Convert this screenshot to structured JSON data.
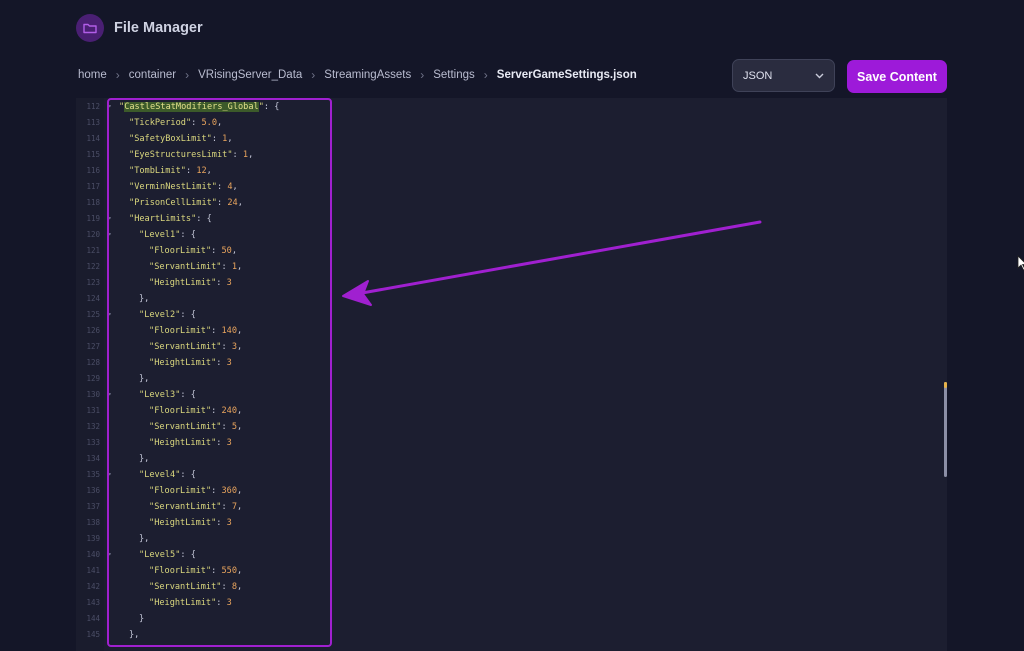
{
  "app": {
    "title": "File Manager",
    "icon": "folder-icon"
  },
  "breadcrumb": {
    "items": [
      "home",
      "container",
      "VRisingServer_Data",
      "StreamingAssets",
      "Settings"
    ],
    "current": "ServerGameSettings.json"
  },
  "toolbar": {
    "format_value": "JSON",
    "save_label": "Save Content"
  },
  "colors": {
    "accent": "#9d1ad9",
    "annotation": "#a020d0",
    "background": "#141628"
  },
  "editor": {
    "lines": [
      {
        "n": "112",
        "fold": true,
        "indent": 1,
        "key": "CastleStatModifiers_Global",
        "value": "",
        "suffix": ": {",
        "highlight": true
      },
      {
        "n": "113",
        "indent": 2,
        "key": "TickPeriod",
        "value": "5.0",
        "suffix": ","
      },
      {
        "n": "114",
        "indent": 2,
        "key": "SafetyBoxLimit",
        "value": "1",
        "suffix": ","
      },
      {
        "n": "115",
        "indent": 2,
        "key": "EyeStructuresLimit",
        "value": "1",
        "suffix": ","
      },
      {
        "n": "116",
        "indent": 2,
        "key": "TombLimit",
        "value": "12",
        "suffix": ","
      },
      {
        "n": "117",
        "indent": 2,
        "key": "VerminNestLimit",
        "value": "4",
        "suffix": ","
      },
      {
        "n": "118",
        "indent": 2,
        "key": "PrisonCellLimit",
        "value": "24",
        "suffix": ","
      },
      {
        "n": "119",
        "fold": true,
        "indent": 2,
        "key": "HeartLimits",
        "value": "",
        "suffix": ": {"
      },
      {
        "n": "120",
        "fold": true,
        "indent": 3,
        "key": "Level1",
        "value": "",
        "suffix": ": {"
      },
      {
        "n": "121",
        "indent": 4,
        "key": "FloorLimit",
        "value": "50",
        "suffix": ","
      },
      {
        "n": "122",
        "indent": 4,
        "key": "ServantLimit",
        "value": "1",
        "suffix": ","
      },
      {
        "n": "123",
        "indent": 4,
        "key": "HeightLimit",
        "value": "3",
        "suffix": ""
      },
      {
        "n": "124",
        "indent": 3,
        "key": "",
        "value": "",
        "suffix": "},"
      },
      {
        "n": "125",
        "fold": true,
        "indent": 3,
        "key": "Level2",
        "value": "",
        "suffix": ": {"
      },
      {
        "n": "126",
        "indent": 4,
        "key": "FloorLimit",
        "value": "140",
        "suffix": ","
      },
      {
        "n": "127",
        "indent": 4,
        "key": "ServantLimit",
        "value": "3",
        "suffix": ","
      },
      {
        "n": "128",
        "indent": 4,
        "key": "HeightLimit",
        "value": "3",
        "suffix": ""
      },
      {
        "n": "129",
        "indent": 3,
        "key": "",
        "value": "",
        "suffix": "},"
      },
      {
        "n": "130",
        "fold": true,
        "indent": 3,
        "key": "Level3",
        "value": "",
        "suffix": ": {"
      },
      {
        "n": "131",
        "indent": 4,
        "key": "FloorLimit",
        "value": "240",
        "suffix": ","
      },
      {
        "n": "132",
        "indent": 4,
        "key": "ServantLimit",
        "value": "5",
        "suffix": ","
      },
      {
        "n": "133",
        "indent": 4,
        "key": "HeightLimit",
        "value": "3",
        "suffix": ""
      },
      {
        "n": "134",
        "indent": 3,
        "key": "",
        "value": "",
        "suffix": "},"
      },
      {
        "n": "135",
        "fold": true,
        "indent": 3,
        "key": "Level4",
        "value": "",
        "suffix": ": {"
      },
      {
        "n": "136",
        "indent": 4,
        "key": "FloorLimit",
        "value": "360",
        "suffix": ","
      },
      {
        "n": "137",
        "indent": 4,
        "key": "ServantLimit",
        "value": "7",
        "suffix": ","
      },
      {
        "n": "138",
        "indent": 4,
        "key": "HeightLimit",
        "value": "3",
        "suffix": ""
      },
      {
        "n": "139",
        "indent": 3,
        "key": "",
        "value": "",
        "suffix": "},"
      },
      {
        "n": "140",
        "fold": true,
        "indent": 3,
        "key": "Level5",
        "value": "",
        "suffix": ": {"
      },
      {
        "n": "141",
        "indent": 4,
        "key": "FloorLimit",
        "value": "550",
        "suffix": ","
      },
      {
        "n": "142",
        "indent": 4,
        "key": "ServantLimit",
        "value": "8",
        "suffix": ","
      },
      {
        "n": "143",
        "indent": 4,
        "key": "HeightLimit",
        "value": "3",
        "suffix": ""
      },
      {
        "n": "144",
        "indent": 3,
        "key": "",
        "value": "",
        "suffix": "}"
      },
      {
        "n": "145",
        "indent": 2,
        "key": "",
        "value": "",
        "suffix": "},"
      }
    ]
  }
}
